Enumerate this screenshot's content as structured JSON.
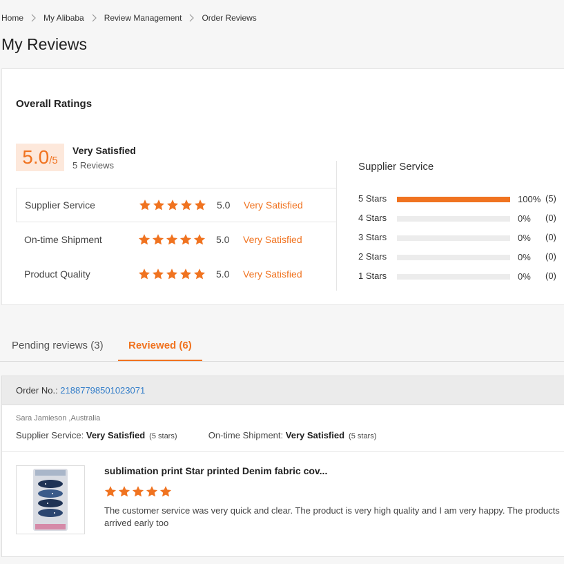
{
  "breadcrumb": {
    "items": [
      "Home",
      "My Alibaba",
      "Review Management",
      "Order Reviews"
    ]
  },
  "page": {
    "title": "My Reviews"
  },
  "overall": {
    "heading": "Overall Ratings",
    "score": "5.0",
    "out_of": "/5",
    "label": "Very Satisfied",
    "count": "5 Reviews",
    "categories": [
      {
        "name": "Supplier Service",
        "stars": 5,
        "value": "5.0",
        "desc": "Very Satisfied"
      },
      {
        "name": "On-time Shipment",
        "stars": 5,
        "value": "5.0",
        "desc": "Very Satisfied"
      },
      {
        "name": "Product Quality",
        "stars": 5,
        "value": "5.0",
        "desc": "Very Satisfied"
      }
    ]
  },
  "supplier_service": {
    "title": "Supplier Service",
    "rows": [
      {
        "label": "5  Stars",
        "fraction": 1.0,
        "pct": "100%",
        "count": "(5)"
      },
      {
        "label": "4  Stars",
        "fraction": 0,
        "pct": "0%",
        "count": "(0)"
      },
      {
        "label": "3  Stars",
        "fraction": 0,
        "pct": "0%",
        "count": "(0)"
      },
      {
        "label": "2  Stars",
        "fraction": 0,
        "pct": "0%",
        "count": "(0)"
      },
      {
        "label": "1  Stars",
        "fraction": 0,
        "pct": "0%",
        "count": "(0)"
      }
    ]
  },
  "tabs": {
    "pending": "Pending reviews (3)",
    "reviewed": "Reviewed (6)"
  },
  "order": {
    "label": "Order No.: ",
    "number": "21887798501023071",
    "reviewer": "Sara Jamieson ,Australia",
    "supplier_service_label": "Supplier Service: ",
    "supplier_service_value": "Very Satisfied",
    "supplier_service_stars": "(5 stars)",
    "shipment_label": "On-time Shipment: ",
    "shipment_value": "Very Satisfied",
    "shipment_stars": "(5 stars)",
    "product_title": "sublimation print Star printed Denim fabric cov...",
    "product_stars": 5,
    "review_text": "The customer service was very quick and clear. The product is very high quality and I am very happy. The products arrived early too"
  },
  "colors": {
    "accent": "#f07320",
    "link": "#2f7bc8"
  },
  "icons": [
    "chevron-right-icon",
    "star-icon"
  ]
}
